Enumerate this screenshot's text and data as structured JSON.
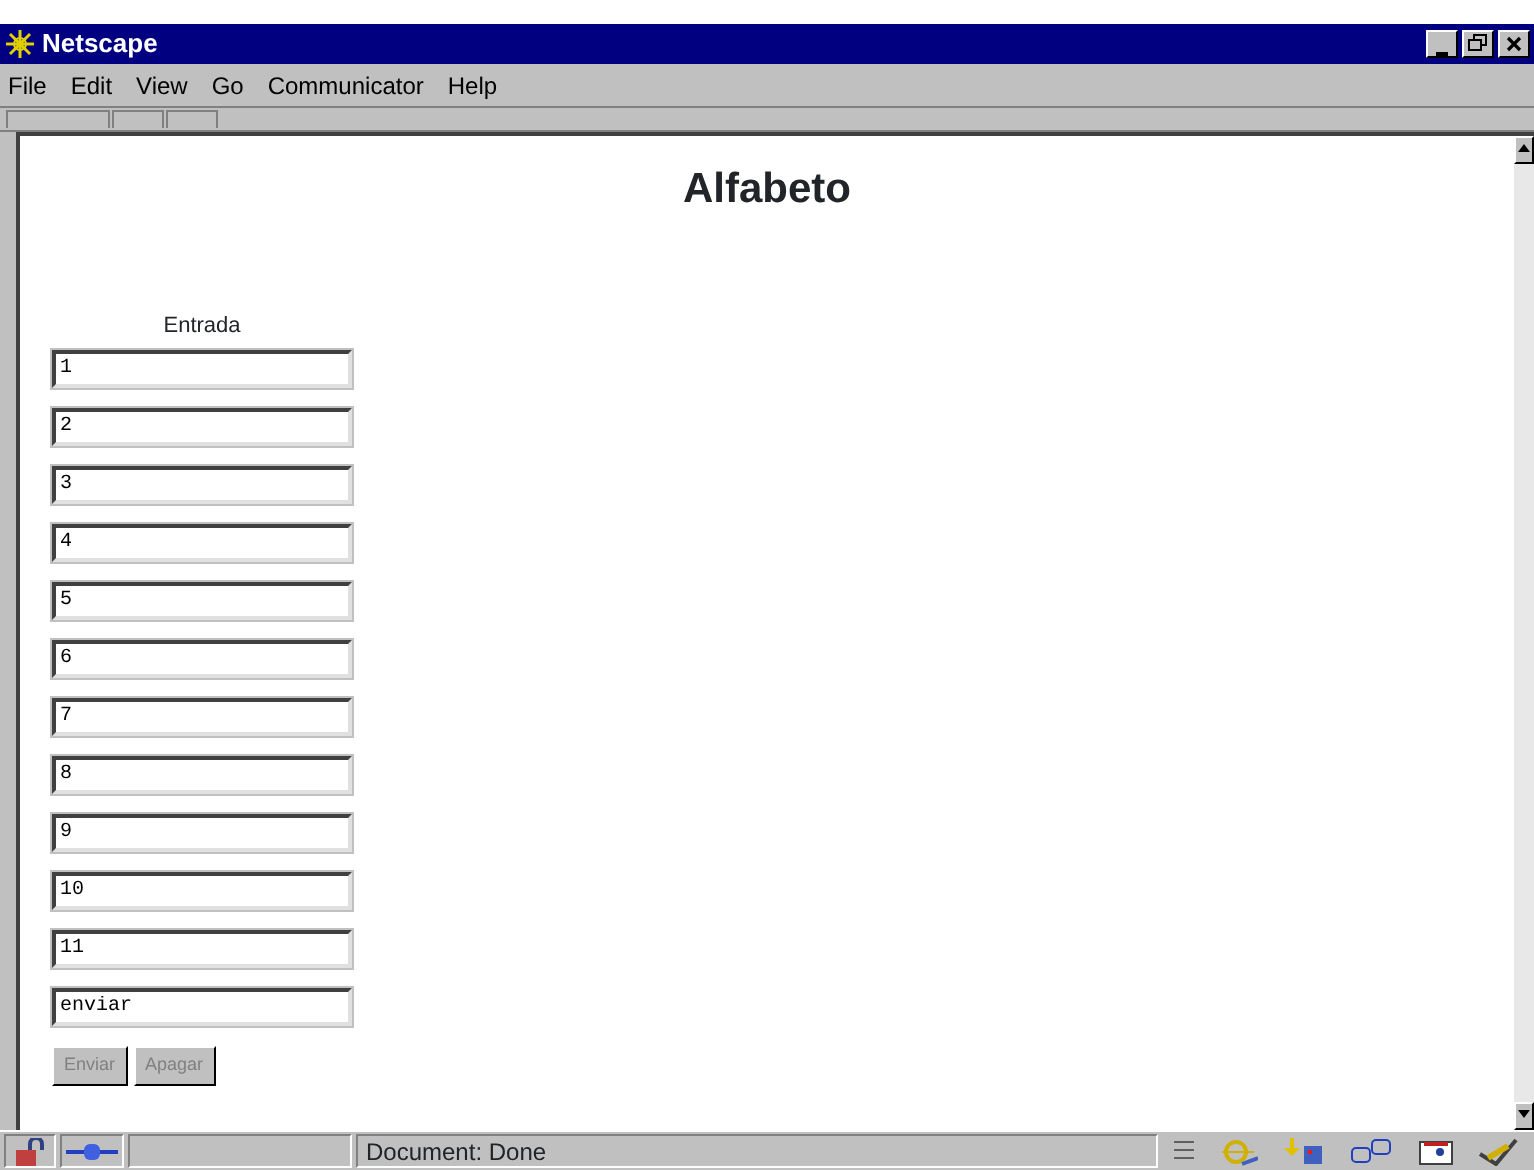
{
  "window": {
    "title": "Netscape"
  },
  "menu": [
    {
      "label": "File"
    },
    {
      "label": "Edit"
    },
    {
      "label": "View"
    },
    {
      "label": "Go"
    },
    {
      "label": "Communicator"
    },
    {
      "label": "Help"
    }
  ],
  "page": {
    "heading": "Alfabeto",
    "form_label": "Entrada",
    "fields": [
      {
        "value": "1"
      },
      {
        "value": "2"
      },
      {
        "value": "3"
      },
      {
        "value": "4"
      },
      {
        "value": "5"
      },
      {
        "value": "6"
      },
      {
        "value": "7"
      },
      {
        "value": "8"
      },
      {
        "value": "9"
      },
      {
        "value": "10"
      },
      {
        "value": "11"
      },
      {
        "value": "enviar"
      }
    ],
    "buttons": [
      {
        "label": "Enviar",
        "disabled": true
      },
      {
        "label": "Apagar",
        "disabled": true
      }
    ]
  },
  "status_bar": {
    "text": "Document: Done"
  }
}
